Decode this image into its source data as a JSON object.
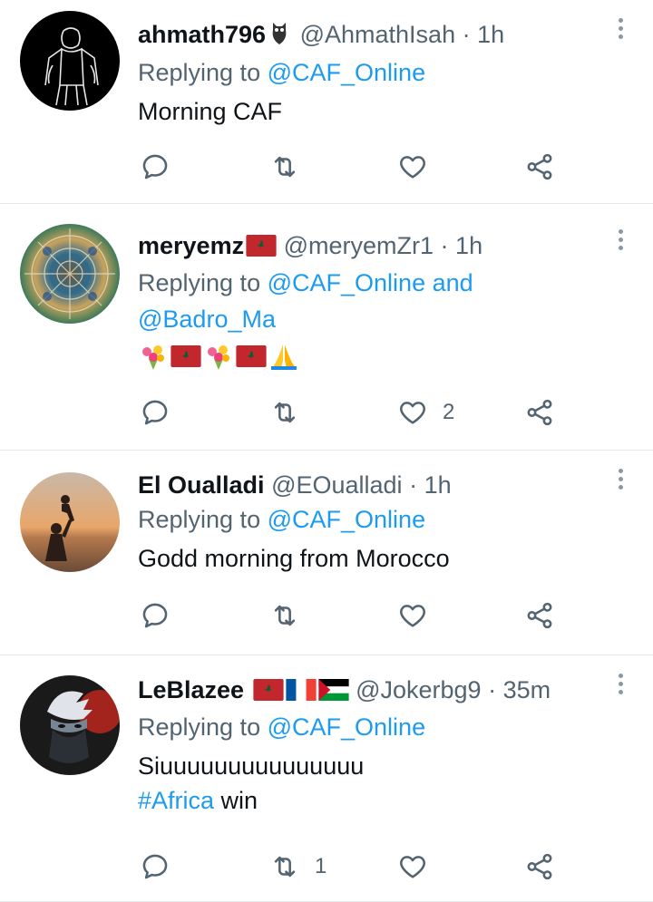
{
  "tweets": [
    {
      "display_name": "ahmath796",
      "handle": "@AhmathIsah",
      "time": "1h",
      "replying_prefix": "Replying to",
      "replying_to": "@CAF_Online",
      "replying_to_2": "",
      "replying_and": "",
      "text": "Morning CAF",
      "retweets": "",
      "likes": ""
    },
    {
      "display_name": "meryemz",
      "handle": "@meryemZr1",
      "time": "1h",
      "replying_prefix": "Replying to",
      "replying_to": "@CAF_Online",
      "replying_and": "and",
      "replying_to_2": "@Badro_Ma",
      "text": "",
      "retweets": "",
      "likes": "2"
    },
    {
      "display_name": "El Oualladi",
      "handle": "@EOualladi",
      "time": "1h",
      "replying_prefix": "Replying to",
      "replying_to": "@CAF_Online",
      "text": "Godd morning from Morocco",
      "retweets": "",
      "likes": ""
    },
    {
      "display_name": "LeBlazee",
      "handle": "@Jokerbg9",
      "time": "35m",
      "replying_prefix": "Replying to",
      "replying_to": "@CAF_Online",
      "text": "Siuuuuuuuuuuuuuuu",
      "hashtag": "#Africa",
      "text_after_hashtag": " win",
      "retweets": "1",
      "likes": ""
    }
  ],
  "separator": "·",
  "icons": {
    "reply": "reply-icon",
    "retweet": "retweet-icon",
    "like": "heart-icon",
    "share": "share-icon",
    "more": "more-vertical-icon"
  },
  "colors": {
    "link": "#1d9bf0",
    "muted": "#536471",
    "text": "#0f1419",
    "divider": "#e1e8ed"
  }
}
